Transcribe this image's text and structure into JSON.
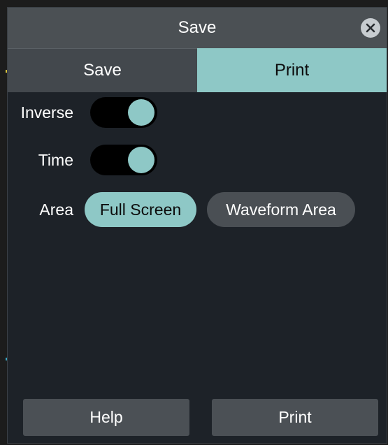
{
  "dialog": {
    "title": "Save",
    "close_icon": "close-icon"
  },
  "tabs": [
    {
      "label": "Save",
      "active": false
    },
    {
      "label": "Print",
      "active": true
    }
  ],
  "settings": {
    "inverse": {
      "label": "Inverse",
      "on": true
    },
    "time": {
      "label": "Time",
      "on": true
    },
    "area": {
      "label": "Area",
      "options": [
        {
          "label": "Full Screen",
          "selected": true
        },
        {
          "label": "Waveform Area",
          "selected": false
        }
      ]
    }
  },
  "footer": {
    "help_label": "Help",
    "print_label": "Print"
  },
  "colors": {
    "accent": "#8ec8c6",
    "panel": "#1d2228",
    "titlebar": "#4b5054",
    "button": "#4b5055"
  }
}
